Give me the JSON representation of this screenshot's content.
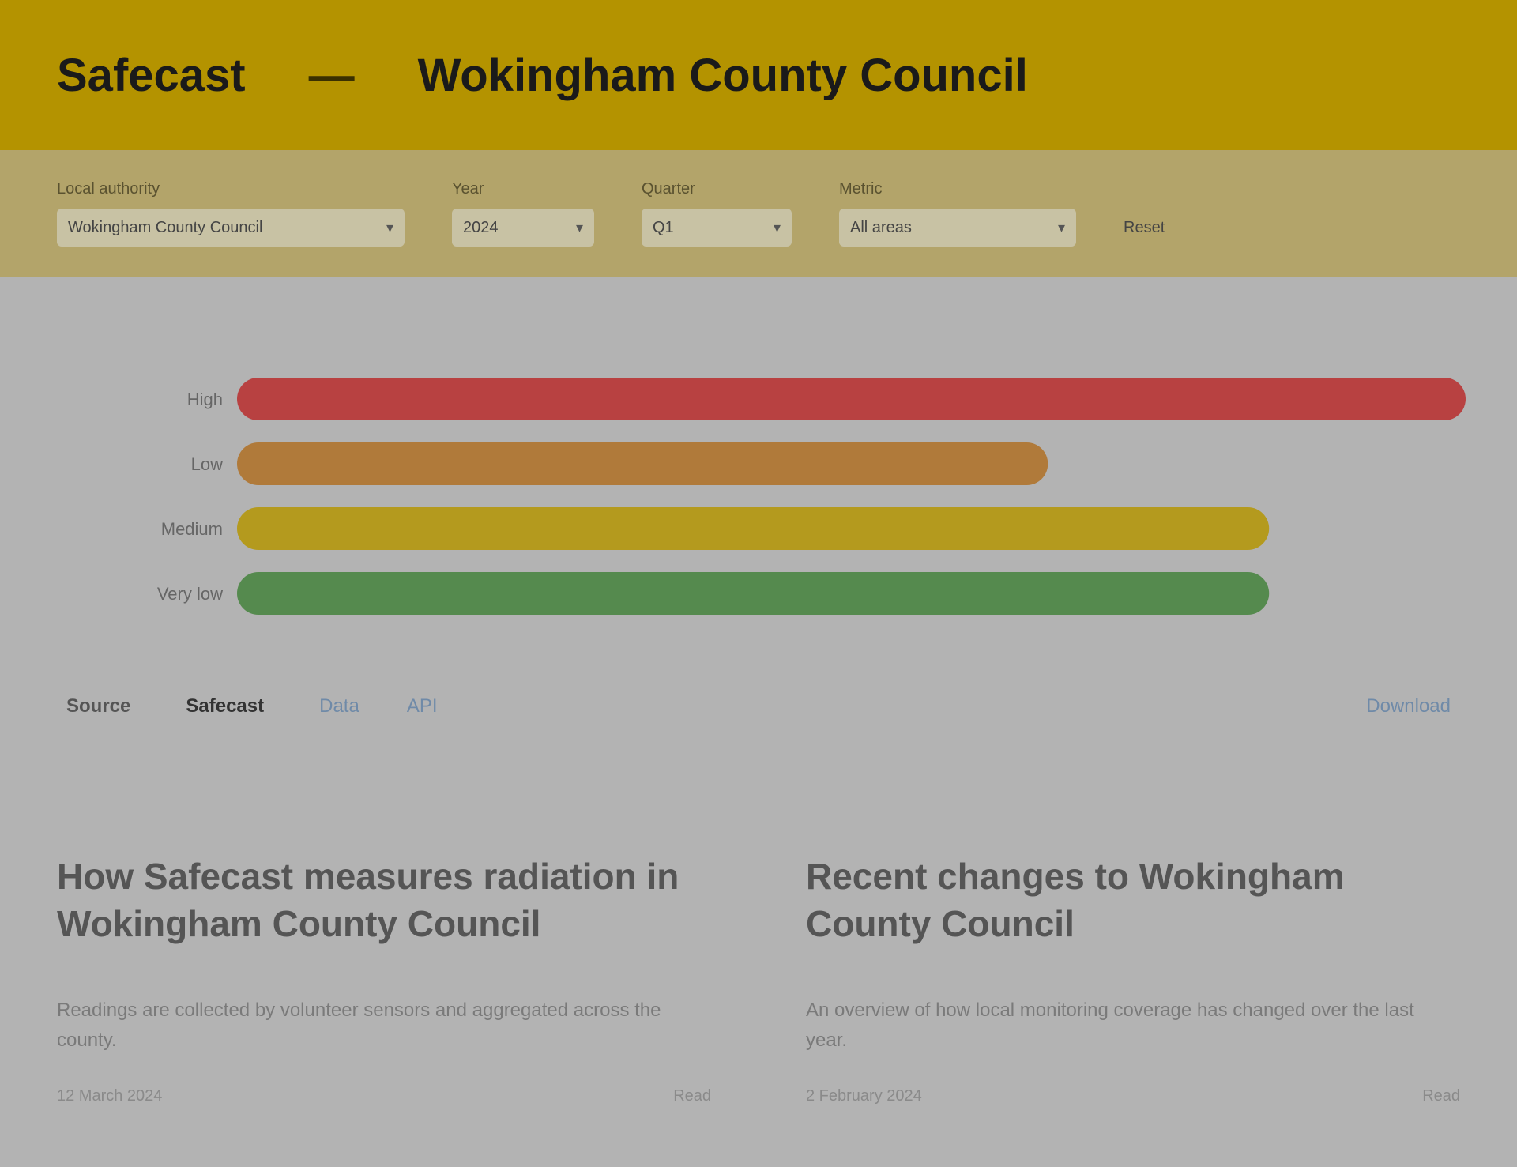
{
  "header": {
    "brand": "Safecast",
    "separator": "—",
    "title": "Wokingham County Council"
  },
  "filters": [
    {
      "label": "Local authority",
      "value": "Wokingham County Council"
    },
    {
      "label": "Year",
      "value": "2024"
    },
    {
      "label": "Quarter",
      "value": "Q1"
    },
    {
      "label": "Metric",
      "value": "All areas"
    }
  ],
  "filters_reset": "Reset",
  "chart_data": {
    "type": "bar",
    "orientation": "horizontal",
    "categories": [
      "High",
      "Low",
      "Medium",
      "Very low"
    ],
    "values": [
      100,
      66,
      84,
      84
    ],
    "colors": [
      "#b84141",
      "#b07a3a",
      "#b49a1e",
      "#558a4e"
    ],
    "xlim": [
      0,
      100
    ],
    "grid": false
  },
  "legend": {
    "key": "Source",
    "value": "Safecast",
    "link1": "Data",
    "link2": "API",
    "more": "Download"
  },
  "articles": [
    {
      "title": "How Safecast measures radiation in Wokingham County Council",
      "body": "Readings are collected by volunteer sensors and aggregated across the county.",
      "date": "12 March 2024",
      "action": "Read"
    },
    {
      "title": "Recent changes to Wokingham County Council",
      "body": "An overview of how local monitoring coverage has changed over the last year.",
      "date": "2 February 2024",
      "action": "Read"
    }
  ]
}
